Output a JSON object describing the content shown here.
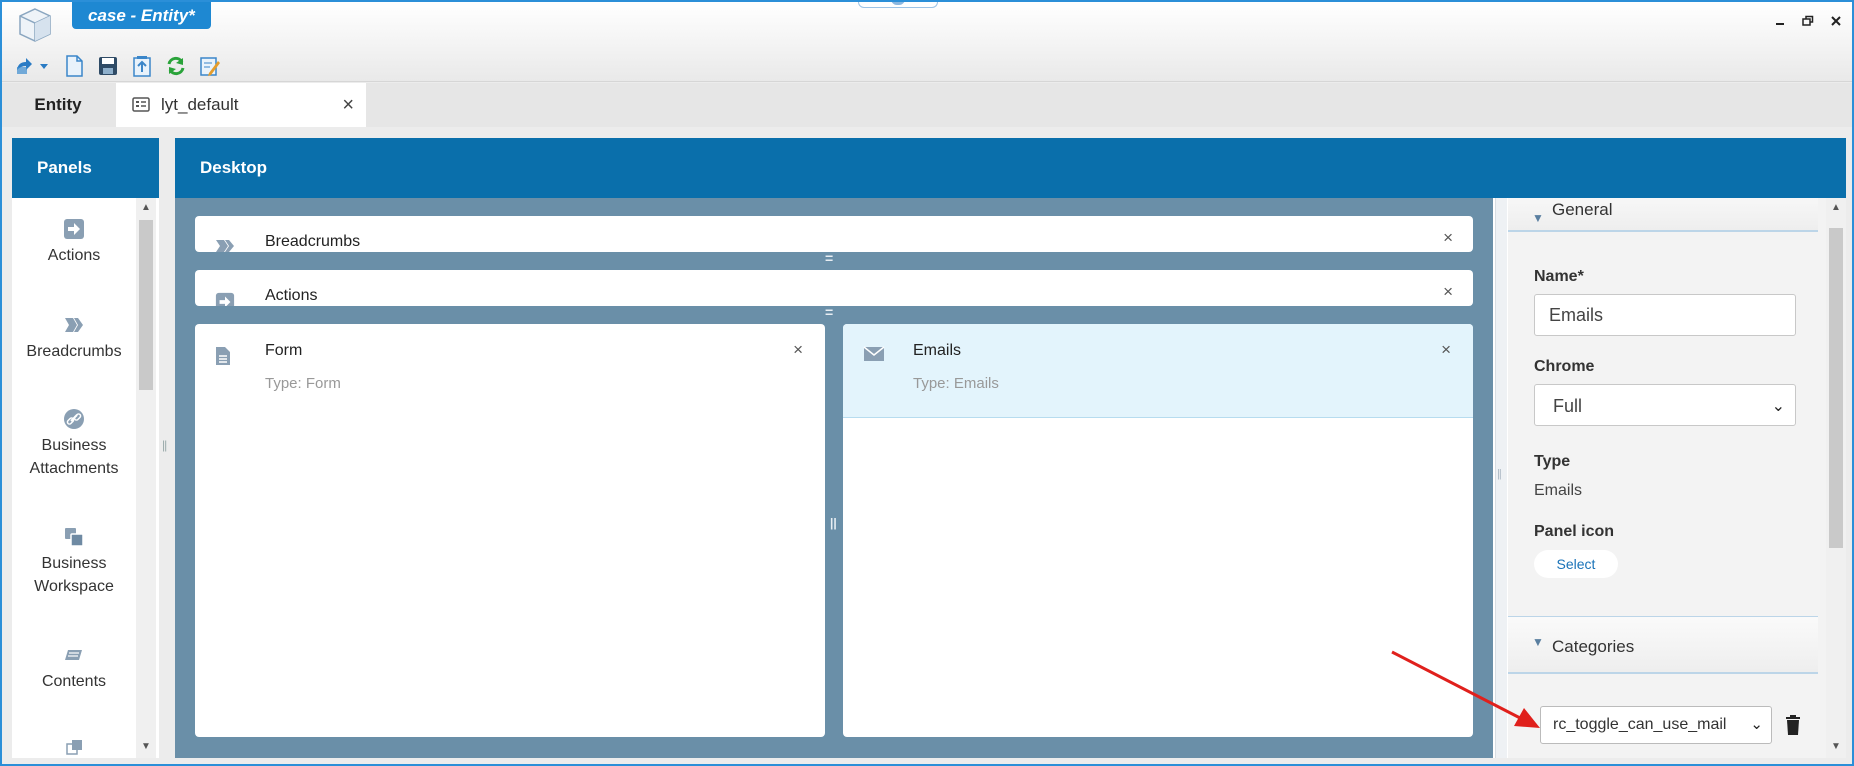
{
  "window": {
    "title": "case - Entity*"
  },
  "tabs": {
    "entity": "Entity",
    "layout": "lyt_default"
  },
  "panels": {
    "header": "Panels",
    "items": [
      {
        "label": "Actions",
        "icon": "actions-icon"
      },
      {
        "label": "Breadcrumbs",
        "icon": "breadcrumbs-icon"
      },
      {
        "label": "Business Attachments",
        "icon": "link-icon"
      },
      {
        "label": "Business Workspace",
        "icon": "workspace-icon"
      },
      {
        "label": "Contents",
        "icon": "contents-icon"
      }
    ]
  },
  "desktop": {
    "header": "Desktop",
    "bars": [
      {
        "label": "Breadcrumbs",
        "icon": "breadcrumbs-icon"
      },
      {
        "label": "Actions",
        "icon": "actions-icon"
      }
    ],
    "cards": [
      {
        "title": "Form",
        "type": "Type: Form",
        "icon": "form-icon",
        "selected": false
      },
      {
        "title": "Emails",
        "type": "Type: Emails",
        "icon": "mail-icon",
        "selected": true
      }
    ]
  },
  "properties": {
    "general": {
      "title": "General",
      "name_label": "Name*",
      "name_value": "Emails",
      "chrome_label": "Chrome",
      "chrome_value": "Full",
      "type_label": "Type",
      "type_value": "Emails",
      "panel_icon_label": "Panel icon",
      "select_button": "Select"
    },
    "categories": {
      "title": "Categories",
      "selected": "rc_toggle_can_use_mail"
    }
  },
  "colors": {
    "accent": "#0a6fab",
    "canvas": "#6a8fa8",
    "selected_card": "#e3f4fc",
    "annotation": "#e0201c"
  }
}
